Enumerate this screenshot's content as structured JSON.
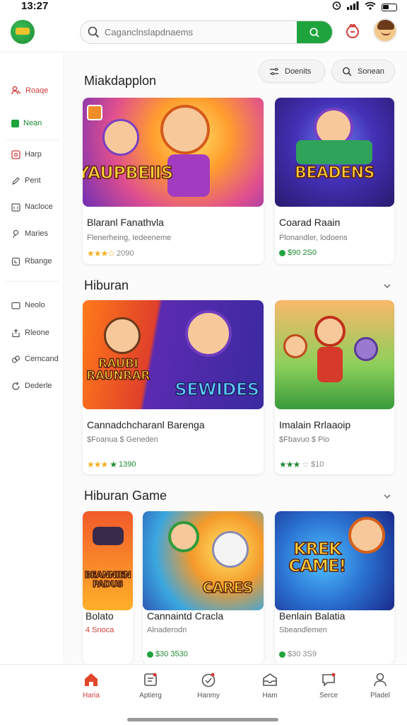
{
  "status": {
    "time": "13:27"
  },
  "search": {
    "placeholder": "Caganclnslapdnaems"
  },
  "sidebar": {
    "items": [
      {
        "label": "Roaqe",
        "icon": "users-icon"
      },
      {
        "label": "Nean",
        "icon": "green-square-icon"
      },
      {
        "label": "Harp",
        "icon": "image-icon"
      },
      {
        "label": "Pent",
        "icon": "edit-icon"
      },
      {
        "label": "Nacloce",
        "icon": "calendar-icon"
      },
      {
        "label": "Maries",
        "icon": "person-icon"
      },
      {
        "label": "Rbange",
        "icon": "lock-icon"
      },
      {
        "label": "Neolo",
        "icon": "folder-icon"
      },
      {
        "label": "Rleone",
        "icon": "upload-icon"
      },
      {
        "label": "Cerncand",
        "icon": "link-icon"
      },
      {
        "label": "Dederle",
        "icon": "refresh-icon"
      }
    ]
  },
  "main": {
    "header": "Miakdapplon",
    "filter_label": "Doenits",
    "sort_label": "Sonean",
    "sections": [
      {
        "title": "",
        "cards": [
          {
            "art": "YAUPBEIIS",
            "title": "Blaranl Fanathvla",
            "sub": "Flenerheing, Iedeeneme",
            "meta": "2090"
          },
          {
            "art": "BEADENS",
            "title": "Coarad Raain",
            "sub": "Plonandler, lodoens",
            "meta": "$90 2S0"
          }
        ]
      },
      {
        "title": "Hiburan",
        "cards": [
          {
            "art": "RAUBI RAUNRAR",
            "art2": "SEWIDES",
            "title": "Cannadchcharanl Barenga",
            "sub": "$Foanua $ Geneden",
            "meta": "1390"
          },
          {
            "art": "",
            "title": "Imalain Rrlaaoip",
            "sub": "$Fbavuo $ Pio",
            "meta": "$10"
          }
        ]
      },
      {
        "title": "Hiburan Game",
        "cards": [
          {
            "art": "BEANNIEN PADUS",
            "title": "Bolato",
            "sub": "4 Snoca",
            "meta": ""
          },
          {
            "art": "CARES",
            "title": "Cannaintd Cracla",
            "sub": "Alnaderodn",
            "meta": "$30 3530"
          },
          {
            "art": "KREK CAME!",
            "title": "Benlain Balatia",
            "sub": "Sbeandlemen",
            "meta": "$30 3S9"
          }
        ]
      }
    ]
  },
  "bottomnav": {
    "items": [
      {
        "label": "Haria",
        "icon": "home-icon"
      },
      {
        "label": "Aptierg",
        "icon": "clipboard-icon"
      },
      {
        "label": "Hanmy",
        "icon": "heart-badge-icon"
      },
      {
        "label": "Ham",
        "icon": "inbox-icon"
      },
      {
        "label": "Serce",
        "icon": "chat-icon"
      },
      {
        "label": "Pladel",
        "icon": "profile-icon"
      }
    ]
  },
  "colors": {
    "accent_green": "#1fa43d",
    "accent_red": "#d23b3b"
  }
}
